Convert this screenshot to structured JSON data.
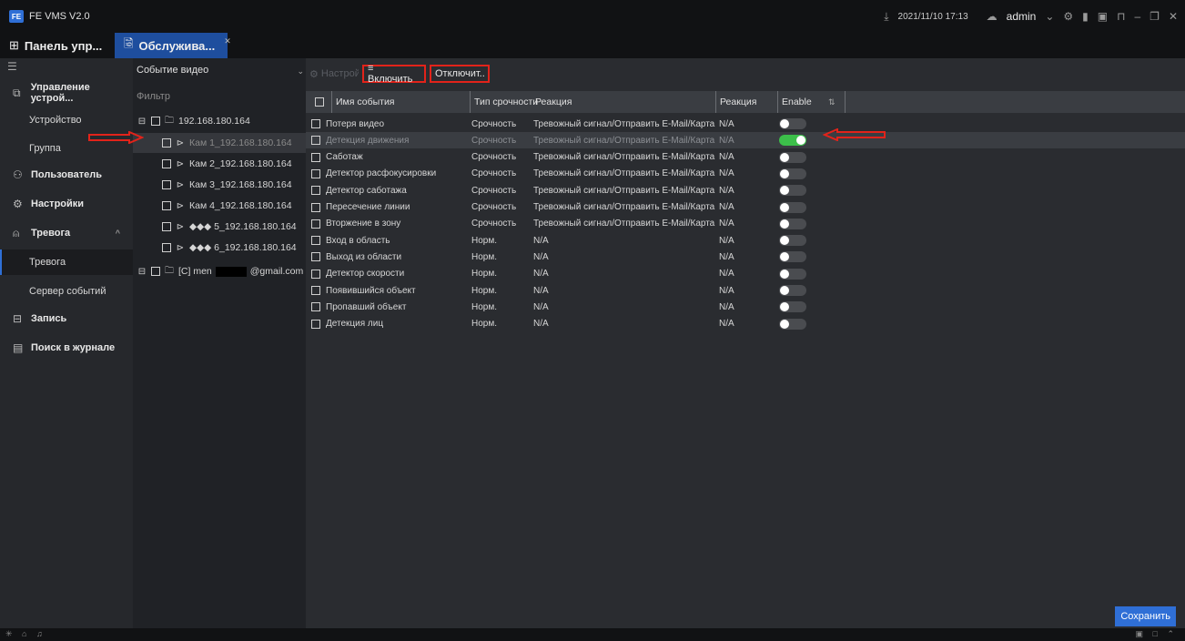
{
  "app": {
    "logo_text": "FE",
    "title": "FE VMS V2.0"
  },
  "titlebar": {
    "download_icon": "download-icon",
    "datetime": "2021/11/10 17:13",
    "user": "admin"
  },
  "tabs": [
    {
      "label": "Панель упр...",
      "icon": "grid-icon"
    },
    {
      "label": "Обслужива...",
      "icon": "maintenance-icon",
      "active": true
    }
  ],
  "sidebar": {
    "items": [
      {
        "label": "Управление устрой...",
        "type": "group",
        "icon": "device-manage-icon"
      },
      {
        "label": "Устройство",
        "type": "sub"
      },
      {
        "label": "Группа",
        "type": "sub"
      },
      {
        "label": "Пользователь",
        "type": "group",
        "icon": "user-icon"
      },
      {
        "label": "Настройки",
        "type": "group",
        "icon": "settings-icon"
      },
      {
        "label": "Тревога",
        "type": "group",
        "icon": "alarm-icon"
      },
      {
        "label": "Тревога",
        "type": "sub",
        "selected": true
      },
      {
        "label": "Сервер событий",
        "type": "sub"
      },
      {
        "label": "Запись",
        "type": "group",
        "icon": "record-icon"
      },
      {
        "label": "Поиск в журнале",
        "type": "group",
        "icon": "log-search-icon"
      }
    ]
  },
  "tree": {
    "select_value": "Событие видео",
    "filter_placeholder": "Фильтр",
    "nodes": [
      {
        "label": "192.168.180.164",
        "level": 0
      },
      {
        "label": "Кам 1_192.168.180.164",
        "level": 1,
        "selected": true
      },
      {
        "label": "Кам 2_192.168.180.164",
        "level": 1
      },
      {
        "label": "Кам 3_192.168.180.164",
        "level": 1
      },
      {
        "label": "Кам 4_192.168.180.164",
        "level": 1
      },
      {
        "label": "◆◆◆ 5_192.168.180.164",
        "level": 1
      },
      {
        "label": "◆◆◆ 6_192.168.180.164",
        "level": 1
      },
      {
        "label_prefix": "[C] men",
        "label_suffix": "@gmail.com",
        "level": 0
      }
    ]
  },
  "toolbar": {
    "settings_label": "Настройки",
    "enable_label": "≡ Включить",
    "disable_label": "Отключит.."
  },
  "table": {
    "headers": [
      "Имя события",
      "Тип срочности",
      "Реакция",
      "Реакция",
      "Enable"
    ],
    "rows": [
      {
        "name": "Потеря видео",
        "urgency": "Срочность",
        "reaction": "Тревожный сигнал/Отправить E-Mail/Карта",
        "reaction2": "N/A",
        "enabled": false
      },
      {
        "name": "Детекция движения",
        "urgency": "Срочность",
        "reaction": "Тревожный сигнал/Отправить E-Mail/Карта",
        "reaction2": "N/A",
        "enabled": true,
        "selected": true
      },
      {
        "name": "Саботаж",
        "urgency": "Срочность",
        "reaction": "Тревожный сигнал/Отправить E-Mail/Карта",
        "reaction2": "N/A",
        "enabled": false
      },
      {
        "name": "Детектор расфокусировки",
        "urgency": "Срочность",
        "reaction": "Тревожный сигнал/Отправить E-Mail/Карта",
        "reaction2": "N/A",
        "enabled": false
      },
      {
        "name": "Детектор саботажа",
        "urgency": "Срочность",
        "reaction": "Тревожный сигнал/Отправить E-Mail/Карта",
        "reaction2": "N/A",
        "enabled": false
      },
      {
        "name": "Пересечение линии",
        "urgency": "Срочность",
        "reaction": "Тревожный сигнал/Отправить E-Mail/Карта",
        "reaction2": "N/A",
        "enabled": false
      },
      {
        "name": "Вторжение в зону",
        "urgency": "Срочность",
        "reaction": "Тревожный сигнал/Отправить E-Mail/Карта",
        "reaction2": "N/A",
        "enabled": false
      },
      {
        "name": "Вход в область",
        "urgency": "Норм.",
        "reaction": "N/A",
        "reaction2": "N/A",
        "enabled": false
      },
      {
        "name": "Выход из области",
        "urgency": "Норм.",
        "reaction": "N/A",
        "reaction2": "N/A",
        "enabled": false
      },
      {
        "name": "Детектор скорости",
        "urgency": "Норм.",
        "reaction": "N/A",
        "reaction2": "N/A",
        "enabled": false
      },
      {
        "name": "Появившийся объект",
        "urgency": "Норм.",
        "reaction": "N/A",
        "reaction2": "N/A",
        "enabled": false
      },
      {
        "name": "Пропавший объект",
        "urgency": "Норм.",
        "reaction": "N/A",
        "reaction2": "N/A",
        "enabled": false
      },
      {
        "name": "Детекция лиц",
        "urgency": "Норм.",
        "reaction": "N/A",
        "reaction2": "N/A",
        "enabled": false
      }
    ]
  },
  "save_label": "Сохранить",
  "colors": {
    "accent": "#2f6fd6",
    "toggle_on": "#3cbf4a",
    "annotation_red": "#e2231a"
  }
}
